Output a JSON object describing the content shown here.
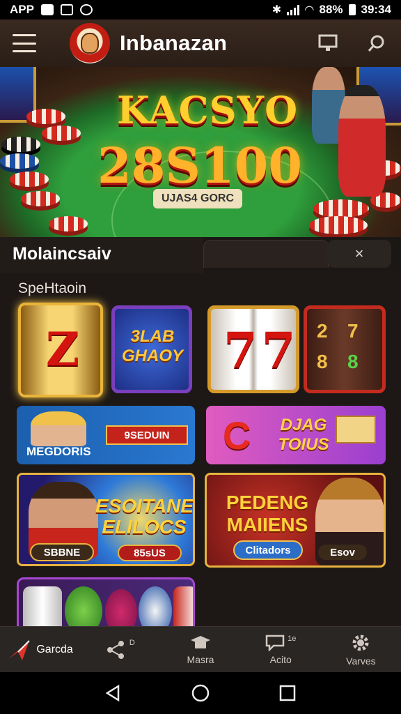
{
  "status_bar": {
    "left_label": "APP",
    "battery": "88%",
    "time": "39:34"
  },
  "header": {
    "title": "Inbanazan"
  },
  "hero": {
    "headline": "KACSYO",
    "amount": "28S100",
    "subtitle": "UJAS4 GORC"
  },
  "panel": {
    "title": "Molaincsaiv",
    "close_label": "×",
    "section_label": "SpeHtaoin"
  },
  "games": {
    "slot_gold_symbol": "Z",
    "slot_blue_text": "3LAB GHAOY",
    "slot_white_symbols": "77",
    "slot_red_numbers": [
      "2",
      "7",
      "8",
      "8"
    ],
    "card_mega_label": "MEGDORIS",
    "card_mega_ribbon": "9SEDUIN",
    "card_purple_letter": "C",
    "card_purple_text": "DJAG TOIUS",
    "card_sports_title": "ESOITANE ELILOCS",
    "card_sports_pill_left": "SBBNE",
    "card_sports_pill_right": "85sUS",
    "card_pending_title": "PEDENG MAIIENS",
    "card_pending_pill": "Clitadors",
    "card_pending_pill_right": "Esov"
  },
  "bottom_nav": {
    "items": [
      {
        "label": "Garcda",
        "icon": "arrow-icon"
      },
      {
        "label": "",
        "icon": "share-icon",
        "badge": "D"
      },
      {
        "label": "Masra",
        "icon": "trophy-icon"
      },
      {
        "label": "Acito",
        "icon": "chat-icon",
        "badge": "1e"
      },
      {
        "label": "Varves",
        "icon": "gear-icon"
      }
    ]
  },
  "colors": {
    "header_bg": "#3a2a20",
    "panel_bg": "#1d1816",
    "accent_gold": "#e8b53a",
    "accent_red": "#c42b1f"
  }
}
